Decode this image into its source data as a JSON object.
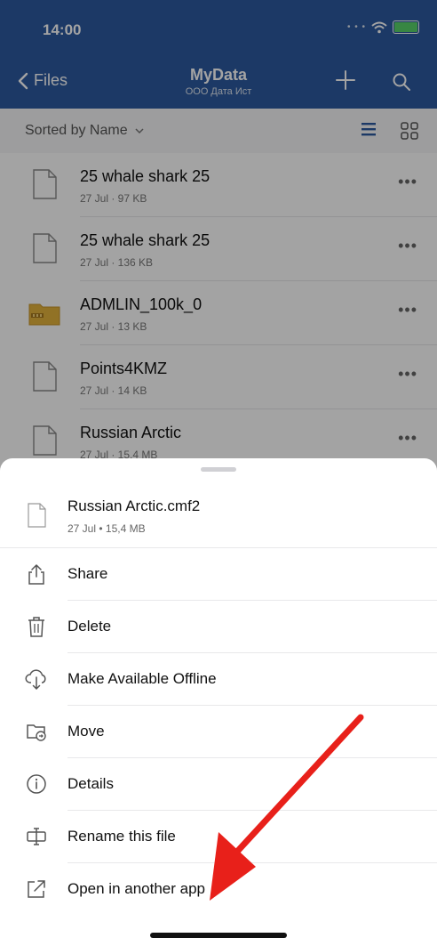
{
  "status_bar": {
    "time": "14:00"
  },
  "nav": {
    "back_label": "Files",
    "title": "MyData",
    "subtitle": "ООО Дата Ист"
  },
  "sort": {
    "label": "Sorted by Name"
  },
  "files": [
    {
      "name": "25 whale shark 25",
      "meta": "27 Jul · 97 KB",
      "icon": "file-icon"
    },
    {
      "name": "25 whale shark 25",
      "meta": "27 Jul · 136 KB",
      "icon": "file-icon"
    },
    {
      "name": "ADMLIN_100k_0",
      "meta": "27 Jul · 13 KB",
      "icon": "zip-folder-icon"
    },
    {
      "name": "Points4KMZ",
      "meta": "27 Jul · 14 KB",
      "icon": "file-icon"
    },
    {
      "name": "Russian Arctic",
      "meta": "27 Jul · 15,4 MB",
      "icon": "file-icon"
    }
  ],
  "sheet": {
    "file_name": "Russian Arctic.cmf2",
    "file_meta": "27 Jul • 15,4 MB",
    "actions": [
      {
        "label": "Share",
        "icon": "share-icon"
      },
      {
        "label": "Delete",
        "icon": "trash-icon"
      },
      {
        "label": "Make Available Offline",
        "icon": "cloud-download-icon"
      },
      {
        "label": "Move",
        "icon": "folder-move-icon"
      },
      {
        "label": "Details",
        "icon": "info-icon"
      },
      {
        "label": "Rename this file",
        "icon": "rename-icon"
      },
      {
        "label": "Open in another app",
        "icon": "open-external-icon"
      }
    ]
  },
  "colors": {
    "header_bg": "#2c5aa0",
    "accent": "#2c5aa0",
    "annotation_arrow": "#e8201a"
  }
}
